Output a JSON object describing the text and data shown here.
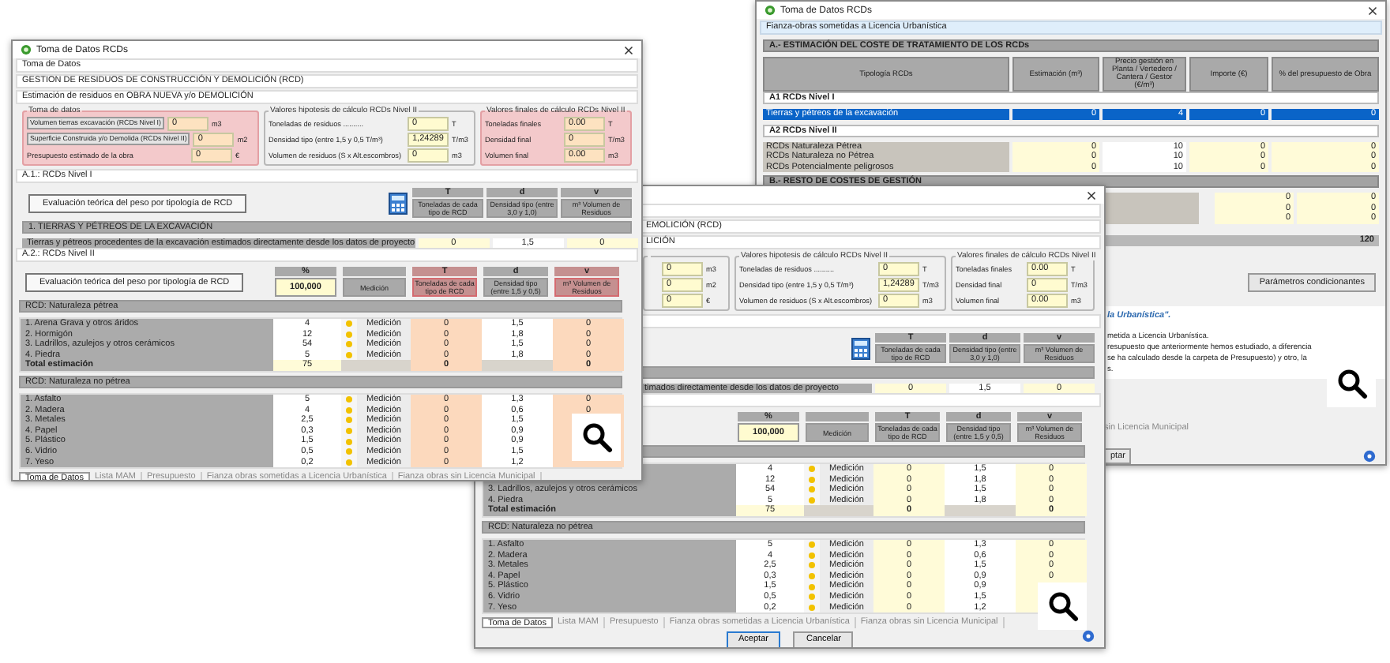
{
  "left_window": {
    "title": "Toma de Datos RCDs",
    "strips": [
      "Toma de Datos",
      "GESTION DE RESIDUOS DE CONSTRUCCIÓN Y DEMOLICIÓN (RCD)",
      "Estimación de residuos en OBRA NUEVA y/o DEMOLICIÓN"
    ],
    "groups": [
      {
        "title": "Toma de datos",
        "highlighted": true,
        "fields": [
          {
            "label": "Volumen tierras excavación (RCDs Nivel I)",
            "kind": "button",
            "value": "0",
            "unit": "m3"
          },
          {
            "label": "Superficie Construida y/o Demolida (RCDs Nivel II)",
            "kind": "button",
            "value": "0",
            "unit": "m2"
          },
          {
            "label": "Presupuesto estimado de la obra",
            "kind": "text",
            "value": "0",
            "unit": "€"
          }
        ]
      },
      {
        "title": "Valores hipotesis de cálculo RCDs Nivel II",
        "highlighted": false,
        "fields": [
          {
            "label": "Toneladas de residuos ..........",
            "kind": "text",
            "value": "0",
            "unit": "T"
          },
          {
            "label": "Densidad tipo (entre 1,5 y 0,5 T/m³)",
            "kind": "text",
            "value": "1,24289",
            "unit": "T/m3"
          },
          {
            "label": "Volumen de residuos (S x Alt.escombros)",
            "kind": "text",
            "value": "0",
            "unit": "m3"
          }
        ]
      },
      {
        "title": "Valores finales de cálculo RCDs Nivel II",
        "highlighted": true,
        "fields": [
          {
            "label": "Toneladas finales",
            "kind": "text",
            "value": "0.00",
            "unit": "T"
          },
          {
            "label": "Densidad final",
            "kind": "text",
            "value": "0",
            "unit": "T/m3"
          },
          {
            "label": "Volumen final",
            "kind": "text",
            "value": "0.00",
            "unit": "m3"
          }
        ]
      }
    ],
    "level1": {
      "title": "A.1.: RCDs Nivel I",
      "button": "Evaluación teórica del peso por tipología de RCD",
      "columns": [
        {
          "symbol": "T",
          "label": "Toneladas de cada tipo de RCD",
          "highlighted": false
        },
        {
          "symbol": "d",
          "label": "Densidad tipo (entre 3,0 y 1,0)",
          "highlighted": false
        },
        {
          "symbol": "v",
          "label": "m³ Volumen de Residuos",
          "highlighted": false
        }
      ],
      "section": "1. TIERRAS Y PÉTREOS DE LA EXCAVACIÓN",
      "row": {
        "label": "Tierras y pétreos procedentes de la excavación estimados directamente desde los datos de proyecto",
        "values": [
          "0",
          "1,5",
          "0"
        ]
      }
    },
    "level2": {
      "title": "A.2.: RCDs Nivel II",
      "button": "Evaluación teórica del peso por tipología de RCD",
      "columns": [
        {
          "symbol": "%",
          "label": "100,000",
          "kind": "value",
          "highlighted": false
        },
        {
          "label": "Medición",
          "kind": "plain",
          "highlighted": false
        },
        {
          "symbol": "T",
          "label": "Toneladas de cada tipo de RCD",
          "kind": "plain",
          "highlighted": true
        },
        {
          "symbol": "d",
          "label": "Densidad tipo (entre 1,5 y 0,5)",
          "kind": "plain",
          "highlighted": false
        },
        {
          "symbol": "v",
          "label": "m³ Volumen de Residuos",
          "kind": "plain",
          "highlighted": true
        }
      ],
      "groups": [
        {
          "title": "RCD: Naturaleza pétrea",
          "rows": [
            {
              "label": "1. Arena Grava y otros áridos",
              "percent": "4",
              "method": "Medición",
              "t": "0",
              "d": "1,5",
              "v": "0"
            },
            {
              "label": "2. Hormigón",
              "percent": "12",
              "method": "Medición",
              "t": "0",
              "d": "1,8",
              "v": "0"
            },
            {
              "label": "3. Ladrillos, azulejos y otros cerámicos",
              "percent": "54",
              "method": "Medición",
              "t": "0",
              "d": "1,5",
              "v": "0"
            },
            {
              "label": "4. Piedra",
              "percent": "5",
              "method": "Medición",
              "t": "0",
              "d": "1,8",
              "v": "0"
            }
          ],
          "total": {
            "label": "Total estimación",
            "percent": "75",
            "t": "0",
            "v": "0"
          }
        },
        {
          "title": "RCD: Naturaleza no pétrea",
          "rows": [
            {
              "label": "1. Asfalto",
              "percent": "5",
              "method": "Medición",
              "t": "0",
              "d": "1,3",
              "v": "0"
            },
            {
              "label": "2. Madera",
              "percent": "4",
              "method": "Medición",
              "t": "0",
              "d": "0,6",
              "v": "0"
            },
            {
              "label": "3. Metales",
              "percent": "2,5",
              "method": "Medición",
              "t": "0",
              "d": "1,5"
            },
            {
              "label": "4. Papel",
              "percent": "0,3",
              "method": "Medición",
              "t": "0",
              "d": "0,9"
            },
            {
              "label": "5. Plástico",
              "percent": "1,5",
              "method": "Medición",
              "t": "0",
              "d": "0,9"
            },
            {
              "label": "6. Vidrio",
              "percent": "0,5",
              "method": "Medición",
              "t": "0",
              "d": "1,5"
            },
            {
              "label": "7. Yeso",
              "percent": "0,2",
              "method": "Medición",
              "t": "0",
              "d": "1,2"
            }
          ]
        }
      ]
    },
    "tabs": [
      {
        "label": "Toma de Datos",
        "selected": true
      },
      {
        "label": "Lista MAM",
        "selected": false
      },
      {
        "label": "Presupuesto",
        "selected": false
      },
      {
        "label": "Fianza obras sometidas a Licencia Urbanística",
        "selected": false
      },
      {
        "label": "Fianza obras sin Licencia Municipal",
        "selected": false
      }
    ]
  },
  "right_window": {
    "title": "Toma de Datos RCDs",
    "caption": "Fianza-obras sometidas a Licencia Urbanística",
    "section_a": "A.- ESTIMACIÓN DEL COSTE DE TRATAMIENTO DE LOS RCDs",
    "columns": [
      "Tipología RCDs",
      "Estimación (m³)",
      "Precio gestión en Planta / Vertedero / Cantera / Gestor (€/m³)",
      "Importe (€)",
      "% del presupuesto de Obra"
    ],
    "groups": [
      {
        "title": "A1 RCDs Nivel I",
        "rows": [
          {
            "label": "Tierras y pétreos de la excavación",
            "values": [
              "0",
              "4",
              "0",
              "0"
            ],
            "selected": true
          }
        ]
      },
      {
        "title": "A2 RCDs Nivel II",
        "rows": [
          {
            "label": "RCDs Naturaleza Pétrea",
            "values": [
              "0",
              "10",
              "0",
              "0"
            ],
            "selected": false
          },
          {
            "label": "RCDs Naturaleza no Pétrea",
            "values": [
              "0",
              "10",
              "0",
              "0"
            ],
            "selected": false
          },
          {
            "label": "RCDs Potencialmente peligrosos",
            "values": [
              "0",
              "10",
              "0",
              "0"
            ],
            "selected": false
          }
        ]
      }
    ],
    "section_b": "B.- RESTO DE COSTES DE GESTIÓN",
    "cost_rows": [
      {
        "values": [
          "0",
          "0"
        ]
      },
      {
        "values": [
          "0",
          "0"
        ]
      },
      {
        "values": [
          "0",
          "0"
        ]
      }
    ],
    "total": "120",
    "button": "Parámetros condicionantes",
    "note_title": "la Urbanística\".",
    "note_lines": [
      "metida a Licencia Urbanística.",
      "resupuesto que anteriormente hemos estudiado, a diferencia",
      "se ha calculado desde la carpeta de Presupuesto) y otro, la",
      "s."
    ],
    "tab": "sin Licencia Municipal",
    "button_fragment": "ptar"
  },
  "bottom_window": {
    "strips": [
      "EMOLICIÓN (RCD)",
      "LICIÓN"
    ],
    "groups": [
      {
        "highlighted": false,
        "fields": [
          {
            "value": "0",
            "unit": "m3"
          },
          {
            "value": "0",
            "unit": "m2"
          },
          {
            "value": "0",
            "unit": "€"
          }
        ]
      },
      {
        "title": "Valores hipotesis de cálculo RCDs Nivel II",
        "highlighted": false,
        "fields": [
          {
            "label": "Toneladas de residuos ..........",
            "kind": "text",
            "value": "0",
            "unit": "T"
          },
          {
            "label": "Densidad tipo (entre 1,5 y 0,5 T/m³)",
            "kind": "text",
            "value": "1,24289",
            "unit": "T/m3"
          },
          {
            "label": "Volumen de residuos (S x Alt.escombros)",
            "kind": "text",
            "value": "0",
            "unit": "m3"
          }
        ]
      },
      {
        "title": "Valores finales de cálculo RCDs Nivel II",
        "highlighted": false,
        "fields": [
          {
            "label": "Toneladas finales",
            "kind": "text",
            "value": "0.00",
            "unit": "T"
          },
          {
            "label": "Densidad final",
            "kind": "text",
            "value": "0",
            "unit": "T/m3"
          },
          {
            "label": "Volumen final",
            "kind": "text",
            "value": "0.00",
            "unit": "m3"
          }
        ]
      }
    ],
    "level1": {
      "columns": [
        {
          "symbol": "T",
          "label": "Toneladas de cada tipo de RCD",
          "highlighted": false
        },
        {
          "symbol": "d",
          "label": "Densidad tipo (entre 3,0 y 1,0)",
          "highlighted": false
        },
        {
          "symbol": "v",
          "label": "m³ Volumen de Residuos",
          "highlighted": false
        }
      ],
      "row": {
        "label": "timados directamente desde los datos de proyecto",
        "values": [
          "0",
          "1,5",
          "0"
        ]
      }
    },
    "level2": {
      "columns": [
        {
          "symbol": "%",
          "label": "100,000",
          "kind": "value",
          "highlighted": false
        },
        {
          "label": "Medición",
          "kind": "plain",
          "highlighted": false
        },
        {
          "symbol": "T",
          "label": "Toneladas de cada tipo de RCD",
          "kind": "plain",
          "highlighted": false
        },
        {
          "symbol": "d",
          "label": "Densidad tipo (entre 1,5 y 0,5)",
          "kind": "plain",
          "highlighted": false
        },
        {
          "symbol": "v",
          "label": "m³ Volumen de Residuos",
          "kind": "plain",
          "highlighted": false
        }
      ],
      "groups": [
        {
          "rows": [
            {
              "percent": "4",
              "method": "Medición",
              "t": "0",
              "d": "1,5",
              "v": "0"
            },
            {
              "percent": "12",
              "method": "Medición",
              "t": "0",
              "d": "1,8",
              "v": "0"
            },
            {
              "label": "3. Ladrillos, azulejos y otros cerámicos",
              "percent": "54",
              "method": "Medición",
              "t": "0",
              "d": "1,5",
              "v": "0"
            },
            {
              "label": "4. Piedra",
              "percent": "5",
              "method": "Medición",
              "t": "0",
              "d": "1,8",
              "v": "0"
            }
          ],
          "total": {
            "label": "Total estimación",
            "percent": "75",
            "t": "0",
            "v": "0"
          }
        },
        {
          "title": "RCD: Naturaleza no pétrea",
          "rows": [
            {
              "label": "1. Asfalto",
              "percent": "5",
              "method": "Medición",
              "t": "0",
              "d": "1,3",
              "v": "0"
            },
            {
              "label": "2. Madera",
              "percent": "4",
              "method": "Medición",
              "t": "0",
              "d": "0,6",
              "v": "0"
            },
            {
              "label": "3. Metales",
              "percent": "2,5",
              "method": "Medición",
              "t": "0",
              "d": "1,5",
              "v": "0"
            },
            {
              "label": "4. Papel",
              "percent": "0,3",
              "method": "Medición",
              "t": "0",
              "d": "0,9",
              "v": "0"
            },
            {
              "label": "5. Plástico",
              "percent": "1,5",
              "method": "Medición",
              "t": "0",
              "d": "0,9"
            },
            {
              "label": "6. Vidrio",
              "percent": "0,5",
              "method": "Medición",
              "t": "0",
              "d": "1,5"
            },
            {
              "label": "7. Yeso",
              "percent": "0,2",
              "method": "Medición",
              "t": "0",
              "d": "1,2"
            }
          ]
        }
      ]
    },
    "tabs": [
      {
        "label": "Toma de Datos",
        "selected": true
      },
      {
        "label": "Lista MAM",
        "selected": false
      },
      {
        "label": "Presupuesto",
        "selected": false
      },
      {
        "label": "Fianza obras sometidas a Licencia Urbanística",
        "selected": false
      },
      {
        "label": "Fianza obras sin Licencia Municipal",
        "selected": false
      }
    ],
    "buttons": [
      {
        "label": "Aceptar",
        "kind": "default"
      },
      {
        "label": "Cancelar",
        "kind": "normal"
      }
    ]
  }
}
